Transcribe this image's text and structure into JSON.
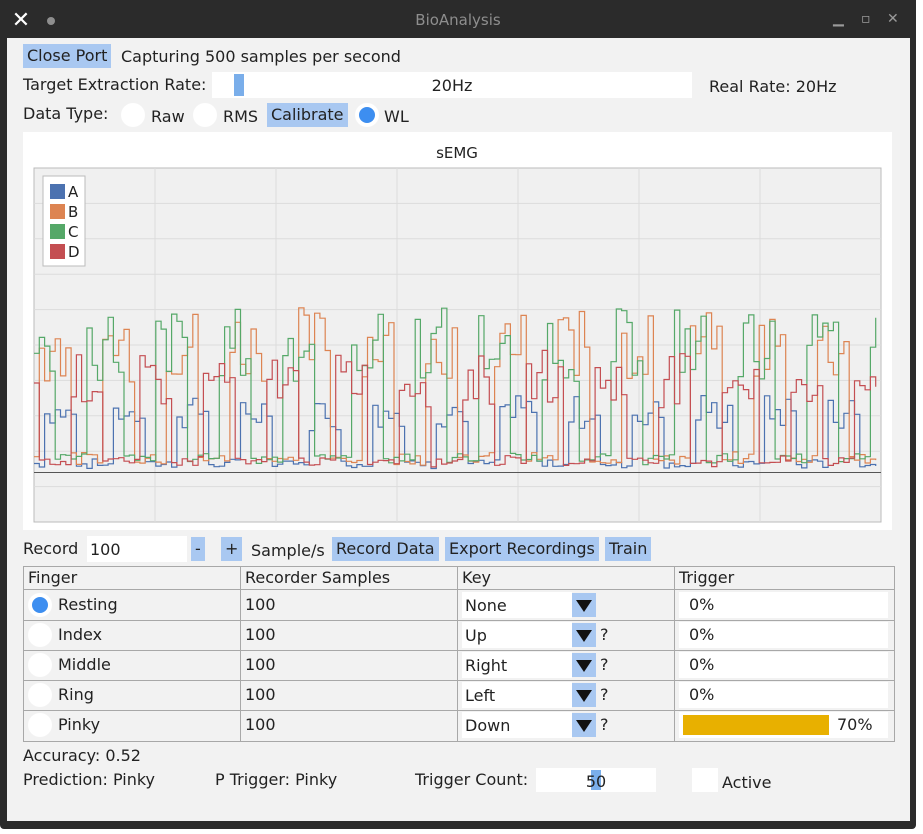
{
  "window": {
    "title": "BioAnalysis"
  },
  "toolbar": {
    "close_port_label": "Close Port",
    "status_text": "Capturing 500 samples per second"
  },
  "extraction": {
    "label": "Target Extraction Rate:",
    "slider_value_text": "20Hz",
    "slider_fraction": 0.03,
    "real_rate": "Real Rate: 20Hz"
  },
  "data_type": {
    "label": "Data Type:",
    "options": [
      {
        "label": "Raw",
        "selected": false
      },
      {
        "label": "RMS",
        "selected": false
      },
      {
        "label": "WL",
        "selected": true
      }
    ],
    "calibrate_label": "Calibrate"
  },
  "chart_data": {
    "type": "line",
    "title": "sEMG",
    "legend_position": "top-left",
    "grid": true,
    "series": [
      {
        "name": "A",
        "color": "#4c72b0"
      },
      {
        "name": "B",
        "color": "#dd8452"
      },
      {
        "name": "C",
        "color": "#55a868"
      },
      {
        "name": "D",
        "color": "#c44e52"
      }
    ]
  },
  "record": {
    "label": "Record",
    "value": "100",
    "minus_label": "-",
    "plus_label": "+",
    "unit_label": "Sample/s",
    "record_data_label": "Record Data",
    "export_label": "Export Recordings",
    "train_label": "Train"
  },
  "table": {
    "headers": [
      "Finger",
      "Recorder Samples",
      "Key",
      "Trigger"
    ],
    "rows": [
      {
        "finger": "Resting",
        "selected": true,
        "samples": "100",
        "key": "None",
        "help": "",
        "trigger": "0%",
        "trigger_fill": 0
      },
      {
        "finger": "Index",
        "selected": false,
        "samples": "100",
        "key": "Up",
        "help": "?",
        "trigger": "0%",
        "trigger_fill": 0
      },
      {
        "finger": "Middle",
        "selected": false,
        "samples": "100",
        "key": "Right",
        "help": "?",
        "trigger": "0%",
        "trigger_fill": 0
      },
      {
        "finger": "Ring",
        "selected": false,
        "samples": "100",
        "key": "Left",
        "help": "?",
        "trigger": "0%",
        "trigger_fill": 0
      },
      {
        "finger": "Pinky",
        "selected": false,
        "samples": "100",
        "key": "Down",
        "help": "?",
        "trigger": "70%",
        "trigger_fill": 0.7
      }
    ]
  },
  "footer": {
    "accuracy": "Accuracy: 0.52",
    "prediction": "Prediction: Pinky",
    "p_trigger": "P Trigger: Pinky",
    "trigger_count_label": "Trigger Count:",
    "trigger_count_value": "50",
    "trigger_count_fraction": 0.5,
    "active_label": "Active",
    "active_checked": false
  },
  "colors": {
    "button": "#a9c8f1",
    "accent": "#3d8ef0",
    "trigger_fill": "#e8b000",
    "titlebar": "#2b2b2b"
  }
}
